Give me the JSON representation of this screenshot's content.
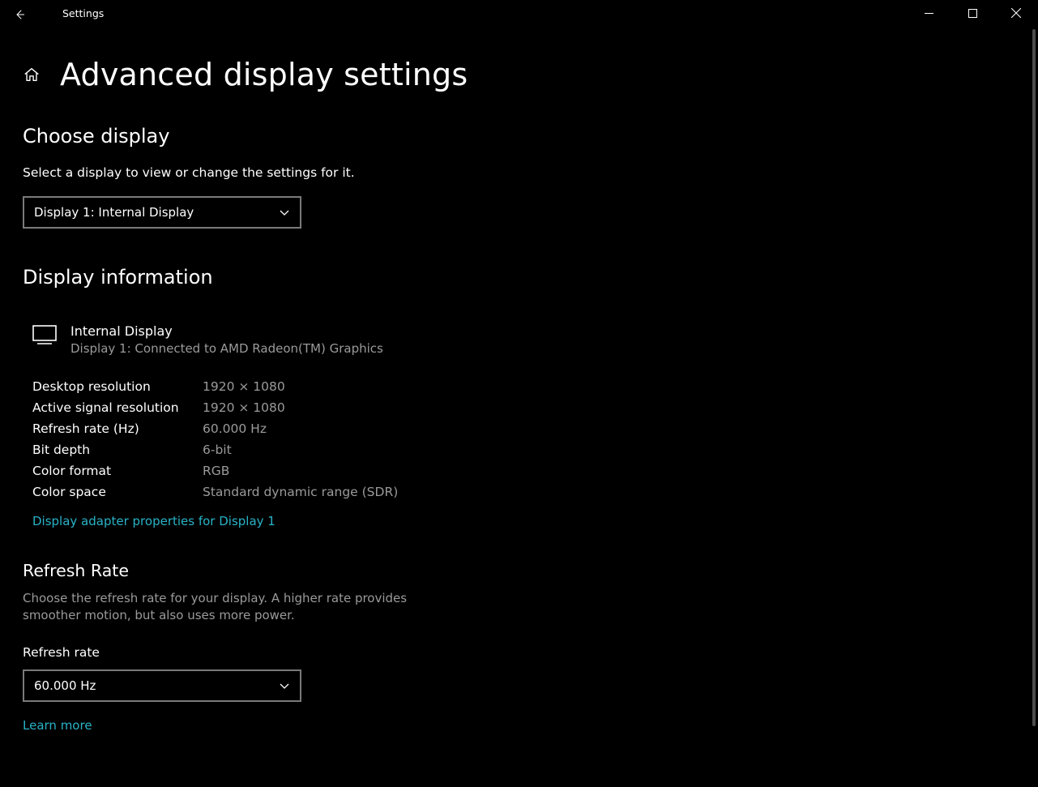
{
  "window": {
    "app": "Settings"
  },
  "page": {
    "title": "Advanced display settings"
  },
  "choose_display": {
    "title": "Choose display",
    "desc": "Select a display to view or change the settings for it.",
    "selected": "Display 1: Internal Display"
  },
  "display_info": {
    "title": "Display information",
    "name": "Internal Display",
    "sub": "Display 1: Connected to AMD Radeon(TM) Graphics",
    "specs": [
      {
        "label": "Desktop resolution",
        "value": "1920 × 1080"
      },
      {
        "label": "Active signal resolution",
        "value": "1920 × 1080"
      },
      {
        "label": "Refresh rate (Hz)",
        "value": "60.000 Hz"
      },
      {
        "label": "Bit depth",
        "value": "6-bit"
      },
      {
        "label": "Color format",
        "value": "RGB"
      },
      {
        "label": "Color space",
        "value": "Standard dynamic range (SDR)"
      }
    ],
    "adapter_link": "Display adapter properties for Display 1"
  },
  "refresh_rate": {
    "title": "Refresh Rate",
    "helper": "Choose the refresh rate for your display. A higher rate provides smoother motion, but also uses more power.",
    "label": "Refresh rate",
    "selected": "60.000 Hz",
    "learn_more": "Learn more"
  }
}
